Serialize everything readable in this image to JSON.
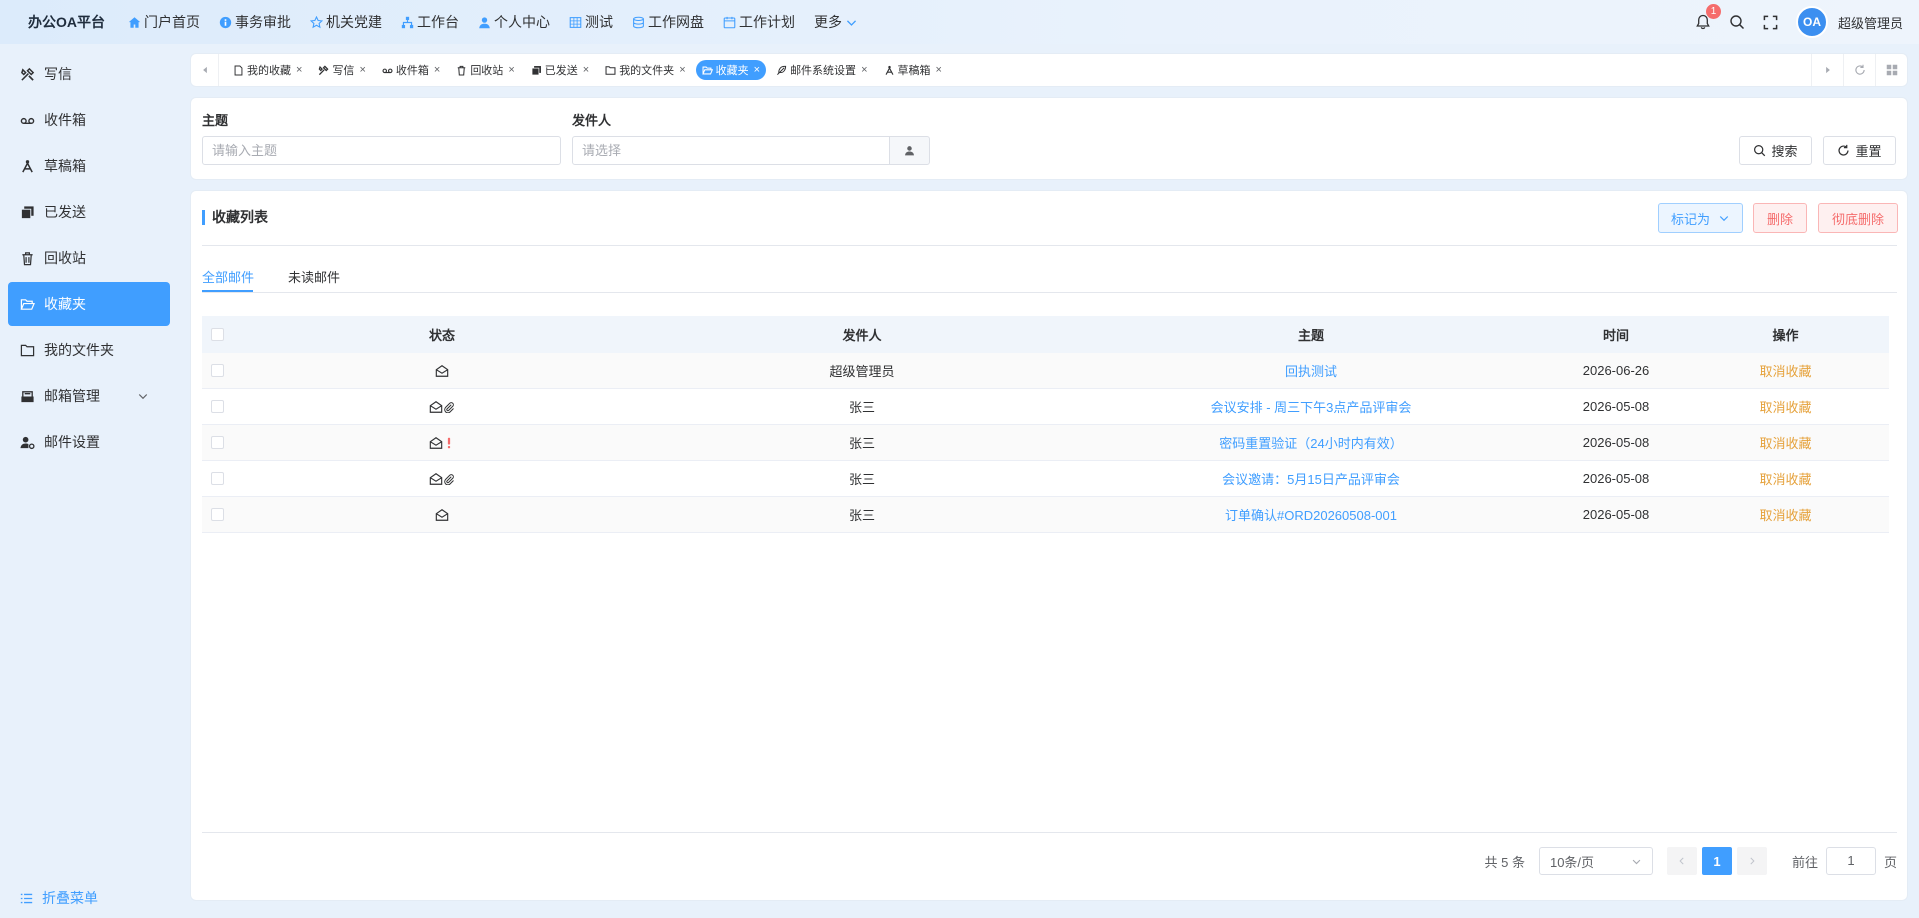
{
  "app": {
    "brand": "办公OA平台"
  },
  "topnav": [
    {
      "label": "门户首页",
      "icon": "home-icon"
    },
    {
      "label": "事务审批",
      "icon": "info-icon"
    },
    {
      "label": "机关党建",
      "icon": "star-icon"
    },
    {
      "label": "工作台",
      "icon": "sitemap-icon"
    },
    {
      "label": "个人中心",
      "icon": "user-icon"
    },
    {
      "label": "测试",
      "icon": "table-icon"
    },
    {
      "label": "工作网盘",
      "icon": "database-icon"
    },
    {
      "label": "工作计划",
      "icon": "calendar-icon"
    },
    {
      "label": "更多",
      "icon": "chevron-down-icon"
    }
  ],
  "header": {
    "notification_count": "1",
    "avatar_text": "OA",
    "username": "超级管理员"
  },
  "sidebar": {
    "items": [
      {
        "label": "写信",
        "icon": "tools-icon"
      },
      {
        "label": "收件箱",
        "icon": "voicemail-icon"
      },
      {
        "label": "草稿箱",
        "icon": "compass-icon"
      },
      {
        "label": "已发送",
        "icon": "copy-icon"
      },
      {
        "label": "回收站",
        "icon": "trash-icon"
      },
      {
        "label": "收藏夹",
        "icon": "folder-open-icon",
        "active": true
      },
      {
        "label": "我的文件夹",
        "icon": "folder-icon"
      },
      {
        "label": "邮箱管理",
        "icon": "inbox-icon"
      },
      {
        "label": "邮件设置",
        "icon": "user-cog-icon"
      }
    ],
    "collapse_label": "折叠菜单"
  },
  "tabs": [
    {
      "label": "我的收藏",
      "icon": "file-icon"
    },
    {
      "label": "写信",
      "icon": "tools-icon"
    },
    {
      "label": "收件箱",
      "icon": "voicemail-icon"
    },
    {
      "label": "回收站",
      "icon": "trash-icon"
    },
    {
      "label": "已发送",
      "icon": "copy-icon"
    },
    {
      "label": "我的文件夹",
      "icon": "folder-icon"
    },
    {
      "label": "收藏夹",
      "icon": "folder-open-icon",
      "active": true
    },
    {
      "label": "邮件系统设置",
      "icon": "feather-icon"
    },
    {
      "label": "草稿箱",
      "icon": "compass-icon"
    }
  ],
  "filter": {
    "subject_label": "主题",
    "subject_placeholder": "请输入主题",
    "sender_label": "发件人",
    "sender_placeholder": "请选择",
    "search_label": "搜索",
    "reset_label": "重置"
  },
  "main": {
    "title": "收藏列表",
    "mark_as_label": "标记为",
    "delete_label": "删除",
    "delete_permanent_label": "彻底删除",
    "subtabs": [
      "全部邮件",
      "未读邮件"
    ],
    "columns": {
      "status": "状态",
      "sender": "发件人",
      "subject": "主题",
      "time": "时间",
      "action": "操作"
    },
    "rows": [
      {
        "status": [
          "envelope-open-icon"
        ],
        "sender": "超级管理员",
        "subject": "回执测试",
        "time": "2026-06-26",
        "action": "取消收藏"
      },
      {
        "status": [
          "envelope-open-icon",
          "paperclip-icon"
        ],
        "sender": "张三",
        "subject": "会议安排 - 周三下午3点产品评审会",
        "time": "2026-05-08",
        "action": "取消收藏"
      },
      {
        "status": [
          "envelope-open-icon",
          "exclamation-icon"
        ],
        "sender": "张三",
        "subject": "密码重置验证（24小时内有效）",
        "time": "2026-05-08",
        "action": "取消收藏"
      },
      {
        "status": [
          "envelope-open-icon",
          "paperclip-icon"
        ],
        "sender": "张三",
        "subject": "会议邀请：5月15日产品评审会",
        "time": "2026-05-08",
        "action": "取消收藏"
      },
      {
        "status": [
          "envelope-open-icon"
        ],
        "sender": "张三",
        "subject": "订单确认#ORD20260508-001",
        "time": "2026-05-08",
        "action": "取消收藏"
      }
    ]
  },
  "pagination": {
    "total_text": "共 5 条",
    "page_size": "10条/页",
    "current_page": "1",
    "goto_label": "前往",
    "goto_value": "1",
    "page_suffix": "页"
  },
  "colors": {
    "accent": "#409eff",
    "danger": "#f56c6c",
    "warning": "#e6a23c"
  }
}
